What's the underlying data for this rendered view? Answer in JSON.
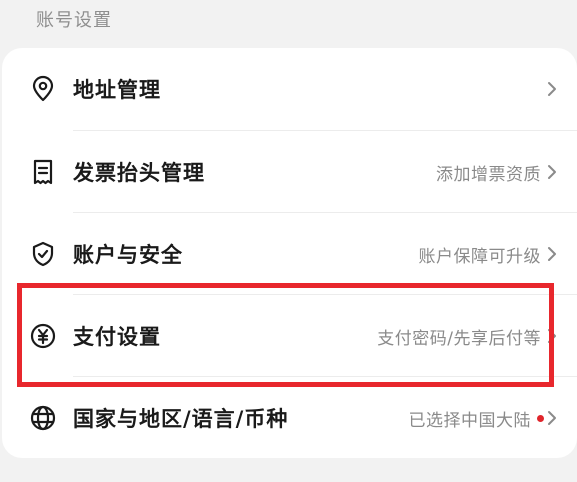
{
  "section": {
    "title": "账号设置"
  },
  "rows": [
    {
      "label": "地址管理",
      "value": ""
    },
    {
      "label": "发票抬头管理",
      "value": "添加增票资质"
    },
    {
      "label": "账户与安全",
      "value": "账户保障可升级"
    },
    {
      "label": "支付设置",
      "value": "支付密码/先享后付等"
    },
    {
      "label": "国家与地区/语言/币种",
      "value": "已选择中国大陆"
    }
  ],
  "colors": {
    "highlight": "#e8272d",
    "badge": "#e0252b"
  }
}
